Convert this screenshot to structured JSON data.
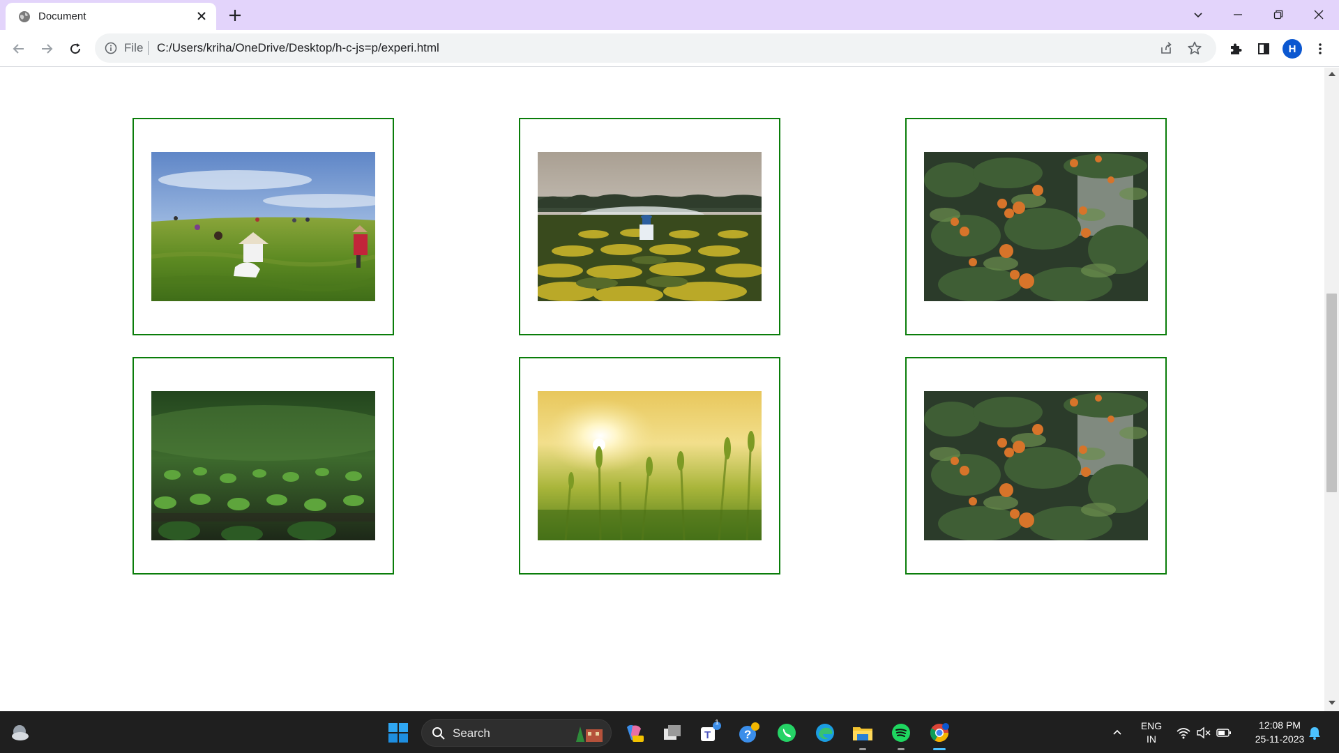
{
  "browser": {
    "tab_title": "Document",
    "url_scheme": "File",
    "url": "C:/Users/kriha/OneDrive/Desktop/h-c-js=p/experi.html",
    "profile_initial": "H"
  },
  "page": {
    "cards": [
      {
        "image": "tea-pickers-field-photo"
      },
      {
        "image": "farmer-spraying-flower-rows-photo"
      },
      {
        "image": "orange-tree-photo"
      },
      {
        "image": "seedlings-closeup-photo"
      },
      {
        "image": "wheat-field-sunset-photo"
      },
      {
        "image": "orange-tree-photo"
      }
    ],
    "border_color": "#0a7d0a"
  },
  "taskbar": {
    "search_label": "Search",
    "teams_badge": "1",
    "language_line1": "ENG",
    "language_line2": "IN",
    "time": "12:08 PM",
    "date": "25-11-2023"
  }
}
